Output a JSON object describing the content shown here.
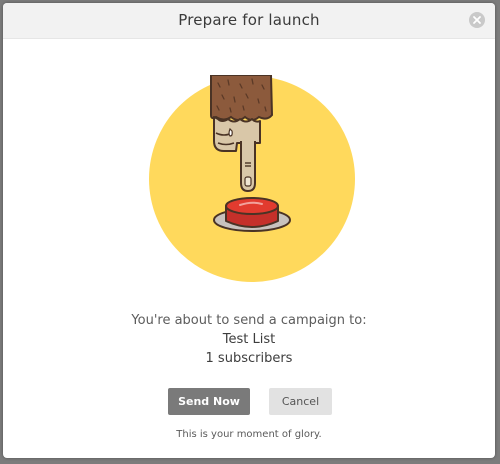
{
  "modal": {
    "title": "Prepare for launch",
    "close_icon": "close-icon"
  },
  "illustration": {
    "icon": "finger-pressing-red-button-illustration",
    "circle_color": "#ffd95c",
    "button_color": "#e23b2f"
  },
  "message": {
    "intro": "You're about to send a campaign to:",
    "list_name": "Test List",
    "subscriber_count": "1 subscribers"
  },
  "actions": {
    "send_label": "Send Now",
    "cancel_label": "Cancel"
  },
  "footer": {
    "note": "This is your moment of glory."
  },
  "colors": {
    "send_button": "#7a7a7a",
    "cancel_button": "#e2e2e2",
    "header_bg": "#f2f2f2"
  }
}
